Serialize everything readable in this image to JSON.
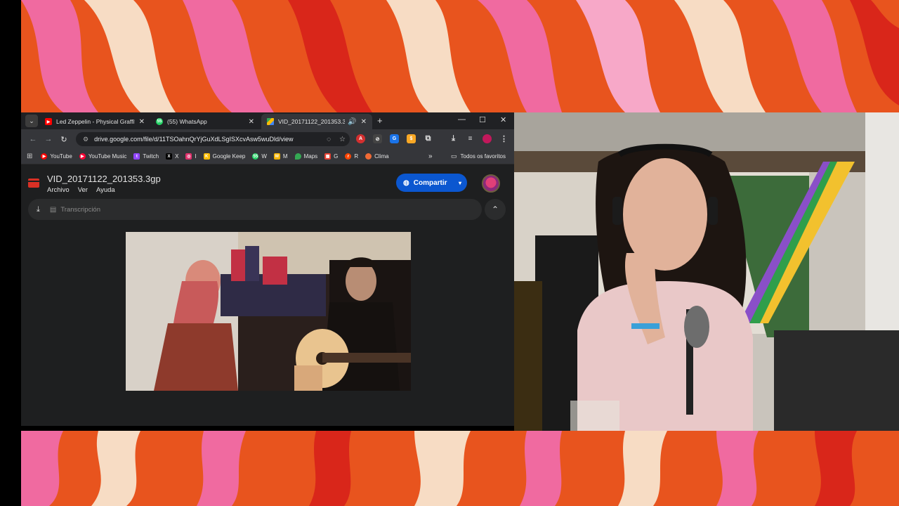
{
  "browser": {
    "tabs": [
      {
        "title": "Led Zeppelin - Physical Graffiti",
        "favicon": "youtube-icon"
      },
      {
        "title": "(55) WhatsApp",
        "favicon": "whatsapp-icon"
      },
      {
        "title": "VID_20171122_201353.3gp",
        "favicon": "google-drive-icon"
      }
    ],
    "url": "drive.google.com/file/d/11TSOahnQrYjGuXdLSgISXcvAsw5wuDld/view",
    "bookmarks": [
      {
        "label": "YouTube",
        "color": "#ff0000"
      },
      {
        "label": "YouTube Music",
        "color": "#ff0033"
      },
      {
        "label": "Twitch",
        "color": "#9146ff"
      },
      {
        "label": "X",
        "color": "#000000"
      },
      {
        "label": "I",
        "color": "#e1306c"
      },
      {
        "label": "Google Keep",
        "color": "#fbbc04"
      },
      {
        "label": "W",
        "color": "#25d366"
      },
      {
        "label": "M",
        "color": "#f4b400"
      },
      {
        "label": "Maps",
        "color": "#34a853"
      },
      {
        "label": "G",
        "color": "#ea4335"
      },
      {
        "label": "R",
        "color": "#ff4500"
      },
      {
        "label": "Clima",
        "color": "#f06a35"
      }
    ],
    "more_bookmarks": "»",
    "all_bookmarks": "Todos os favoritos"
  },
  "drive": {
    "file_name": "VID_20171122_201353.3gp",
    "menus": [
      "Archivo",
      "Ver",
      "Ayuda"
    ],
    "share_label": "Compartir",
    "transcription_label": "Transcripción"
  },
  "colors": {
    "accent": "#0b57d0",
    "swirl_red": "#e8541e",
    "swirl_pink": "#f06aa0",
    "swirl_cream": "#f7dcc4"
  }
}
